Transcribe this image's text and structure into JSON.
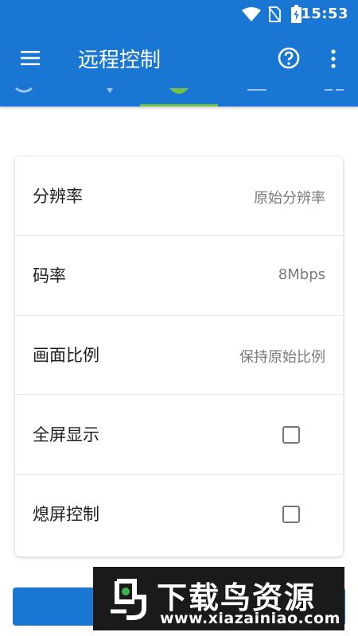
{
  "status_bar": {
    "time": "15:53",
    "icons": [
      "wifi-icon",
      "no-sim-icon",
      "battery-charging-icon"
    ]
  },
  "app_bar": {
    "title": "远程控制",
    "icons": [
      "menu-icon",
      "help-icon",
      "more-vert-icon"
    ]
  },
  "settings": {
    "resolution": {
      "label": "分辨率",
      "value": "原始分辨率"
    },
    "bitrate": {
      "label": "码率",
      "value": "8Mbps"
    },
    "aspect_ratio": {
      "label": "画面比例",
      "value": "保持原始比例"
    },
    "fullscreen": {
      "label": "全屏显示",
      "checked": false
    },
    "screen_off": {
      "label": "熄屏控制",
      "checked": false
    }
  },
  "watermark": {
    "brand": "下载鸟资源",
    "url": "www.xiazainiao.com"
  },
  "colors": {
    "primary": "#1976d2",
    "tab_indicator": "#76c043",
    "watermark_bg": "#1a1a1a"
  }
}
